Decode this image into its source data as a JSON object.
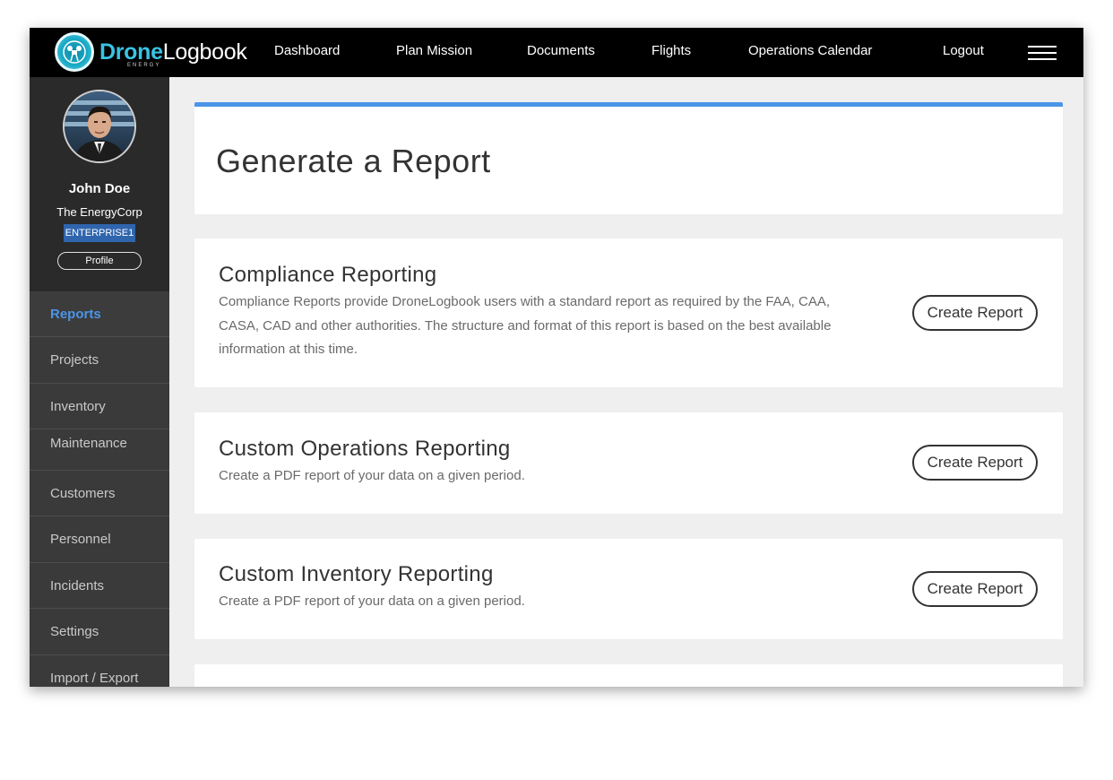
{
  "brand": {
    "name_part1": "Drone",
    "name_part2": "Logbook",
    "subtitle": "ENERGY",
    "accent_color": "#3bc3e2"
  },
  "nav": {
    "items": [
      {
        "label": "Dashboard"
      },
      {
        "label": "Plan Mission"
      },
      {
        "label": "Documents"
      },
      {
        "label": "Flights"
      },
      {
        "label": "Operations Calendar"
      },
      {
        "label": "Logout"
      }
    ],
    "menu_icon": "hamburger-menu-icon"
  },
  "user": {
    "name": "John Doe",
    "org": "The EnergyCorp",
    "plan": "ENTERPRISE1",
    "profile_button": "Profile"
  },
  "sidebar": {
    "items": [
      {
        "label": "Reports",
        "active": true
      },
      {
        "label": "Projects"
      },
      {
        "label": "Inventory"
      },
      {
        "label": "Maintenance"
      },
      {
        "label": "Customers"
      },
      {
        "label": "Personnel"
      },
      {
        "label": "Incidents"
      },
      {
        "label": "Settings"
      },
      {
        "label": "Import / Export"
      }
    ],
    "active_color": "#4a95e8"
  },
  "main": {
    "title": "Generate a Report",
    "cards": [
      {
        "title": "Compliance Reporting",
        "description": "Compliance Reports provide DroneLogbook users with a standard report as required by the FAA, CAA, CASA, CAD and other authorities. The structure and format of this report is based on the best available information at this time.",
        "button": "Create Report"
      },
      {
        "title": "Custom Operations Reporting",
        "description": "Create a PDF report of your data on a given period.",
        "button": "Create Report"
      },
      {
        "title": "Custom Inventory Reporting",
        "description": "Create a PDF report of your data on a given period.",
        "button": "Create Report"
      }
    ]
  }
}
